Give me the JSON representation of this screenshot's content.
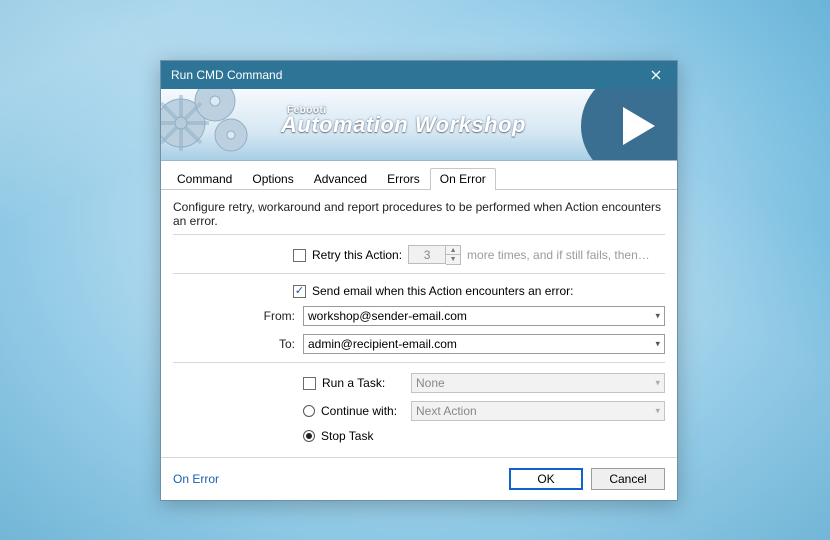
{
  "window": {
    "title": "Run CMD Command"
  },
  "banner": {
    "brand_small": "Febooti",
    "brand_big": "Automation Workshop"
  },
  "tabs": [
    "Command",
    "Options",
    "Advanced",
    "Errors",
    "On Error"
  ],
  "active_tab_index": 4,
  "content": {
    "description": "Configure retry, workaround and report procedures to be performed when Action encounters an error.",
    "retry": {
      "label": "Retry this Action:",
      "checked": false,
      "count": "3",
      "hint": "more times, and if still fails, then…"
    },
    "email": {
      "label": "Send email when this Action encounters an error:",
      "checked": true,
      "from_label": "From:",
      "from_value": "workshop@sender-email.com",
      "to_label": "To:",
      "to_value": "admin@recipient-email.com"
    },
    "actions": {
      "run_task": {
        "label": "Run a Task:",
        "checked": false,
        "value": "None"
      },
      "continue": {
        "label": "Continue with:",
        "selected": false,
        "value": "Next Action"
      },
      "stop": {
        "label": "Stop Task",
        "selected": true
      }
    }
  },
  "footer": {
    "link": "On Error",
    "ok": "OK",
    "cancel": "Cancel"
  }
}
